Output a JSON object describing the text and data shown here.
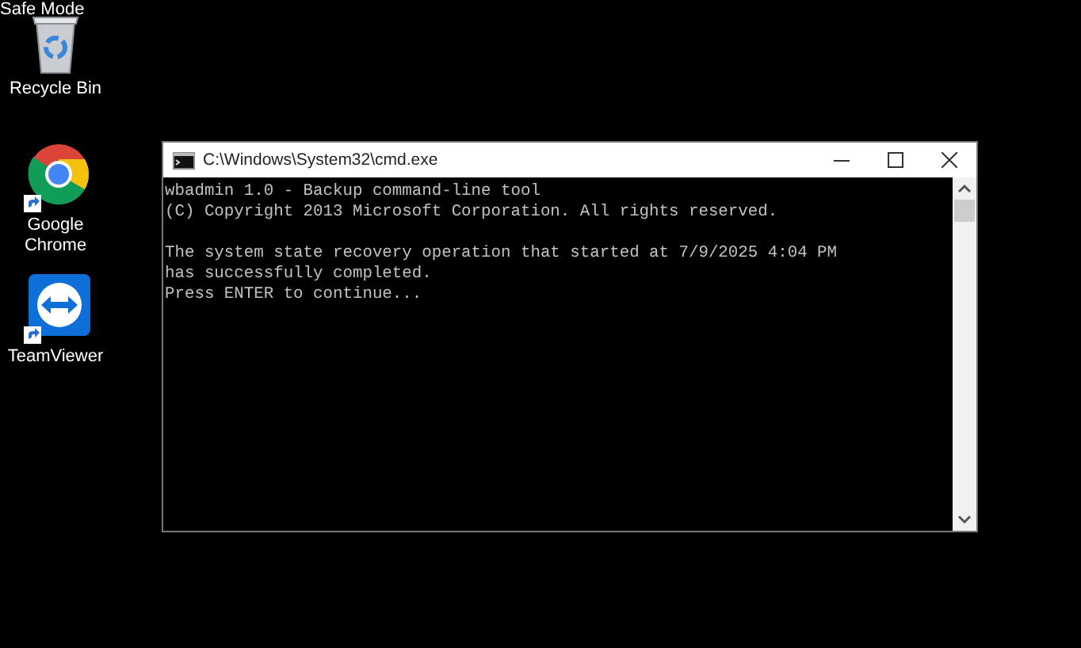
{
  "desktop": {
    "mode_label": "Safe Mode",
    "icons": [
      {
        "kind": "recycle-bin",
        "label": "Recycle Bin",
        "shortcut": false
      },
      {
        "kind": "browser",
        "label": "Google Chrome",
        "shortcut": true
      },
      {
        "kind": "remote",
        "label": "TeamViewer",
        "shortcut": true
      }
    ]
  },
  "window": {
    "title": "C:\\Windows\\System32\\cmd.exe",
    "console_blocks": [
      [
        "wbadmin 1.0 - Backup command-line tool",
        "(C) Copyright 2013 Microsoft Corporation. All rights reserved."
      ],
      [
        "The system state recovery operation that started at 7/9/2025 4:04 PM",
        "has successfully completed.",
        "Press ENTER to continue..."
      ]
    ]
  }
}
